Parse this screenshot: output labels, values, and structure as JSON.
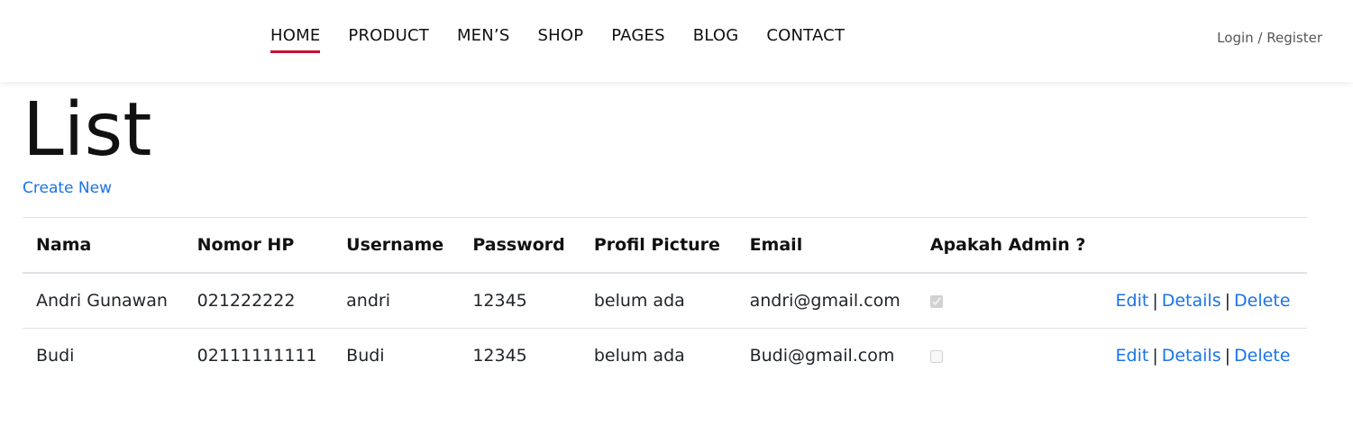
{
  "nav": {
    "items": [
      {
        "label": "HOME",
        "active": true
      },
      {
        "label": "PRODUCT"
      },
      {
        "label": "MEN’S"
      },
      {
        "label": "SHOP"
      },
      {
        "label": "PAGES"
      },
      {
        "label": "BLOG"
      },
      {
        "label": "CONTACT"
      }
    ],
    "login": "Login / Register",
    "accent_color": "#c8102e"
  },
  "page": {
    "title": "List",
    "create_new": "Create New"
  },
  "table": {
    "headers": [
      "Nama",
      "Nomor HP",
      "Username",
      "Password",
      "Profil Picture",
      "Email",
      "Apakah Admin ?",
      ""
    ],
    "rows": [
      {
        "nama": "Andri Gunawan",
        "hp": "021222222",
        "username": "andri",
        "password": "12345",
        "picture": "belum ada",
        "email": "andri@gmail.com",
        "admin": true
      },
      {
        "nama": "Budi",
        "hp": "02111111111",
        "username": "Budi",
        "password": "12345",
        "picture": "belum ada",
        "email": "Budi@gmail.com",
        "admin": false
      }
    ],
    "actions": {
      "edit": "Edit",
      "details": "Details",
      "delete": "Delete",
      "separator": "|"
    }
  }
}
